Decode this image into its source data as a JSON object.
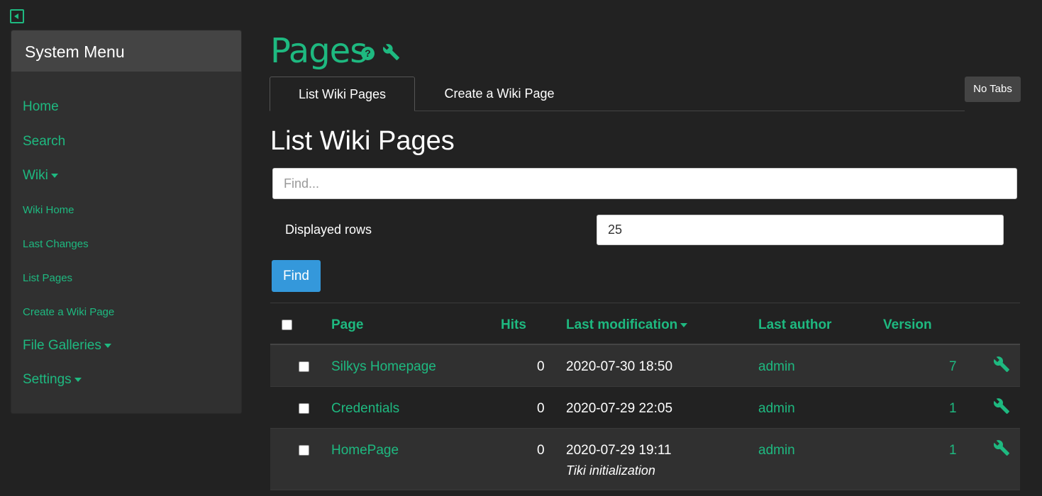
{
  "sidebar": {
    "title": "System Menu",
    "items": [
      {
        "label": "Home"
      },
      {
        "label": "Search"
      },
      {
        "label": "Wiki"
      },
      {
        "label": "Wiki Home"
      },
      {
        "label": "Last Changes"
      },
      {
        "label": "List Pages"
      },
      {
        "label": "Create a Wiki Page"
      },
      {
        "label": "File Galleries"
      },
      {
        "label": "Settings"
      }
    ]
  },
  "page": {
    "title": "Pages",
    "help_glyph": "?",
    "tabs": [
      {
        "label": "List Wiki Pages"
      },
      {
        "label": "Create a Wiki Page"
      }
    ],
    "no_tabs_label": "No Tabs",
    "section_title": "List Wiki Pages"
  },
  "filter": {
    "find_placeholder": "Find...",
    "rows_label": "Displayed rows",
    "rows_value": "25",
    "find_button": "Find"
  },
  "table": {
    "headers": {
      "page": "Page",
      "hits": "Hits",
      "last_modification": "Last modification",
      "last_author": "Last author",
      "version": "Version"
    },
    "rows": [
      {
        "page": "Silkys Homepage",
        "hits": "0",
        "modified": "2020-07-30 18:50",
        "author": "admin",
        "version": "7",
        "description": ""
      },
      {
        "page": "Credentials",
        "hits": "0",
        "modified": "2020-07-29 22:05",
        "author": "admin",
        "version": "1",
        "description": ""
      },
      {
        "page": "HomePage",
        "hits": "0",
        "modified": "2020-07-29 19:11",
        "author": "admin",
        "version": "1",
        "description": "Tiki initialization"
      }
    ]
  },
  "colors": {
    "accent": "#1eb980",
    "background": "#222222",
    "button_primary": "#3498db"
  },
  "icons": {
    "sidebar_toggle": "caret-left-square-icon",
    "help": "question-circle-icon",
    "actions": "wrench-icon"
  }
}
